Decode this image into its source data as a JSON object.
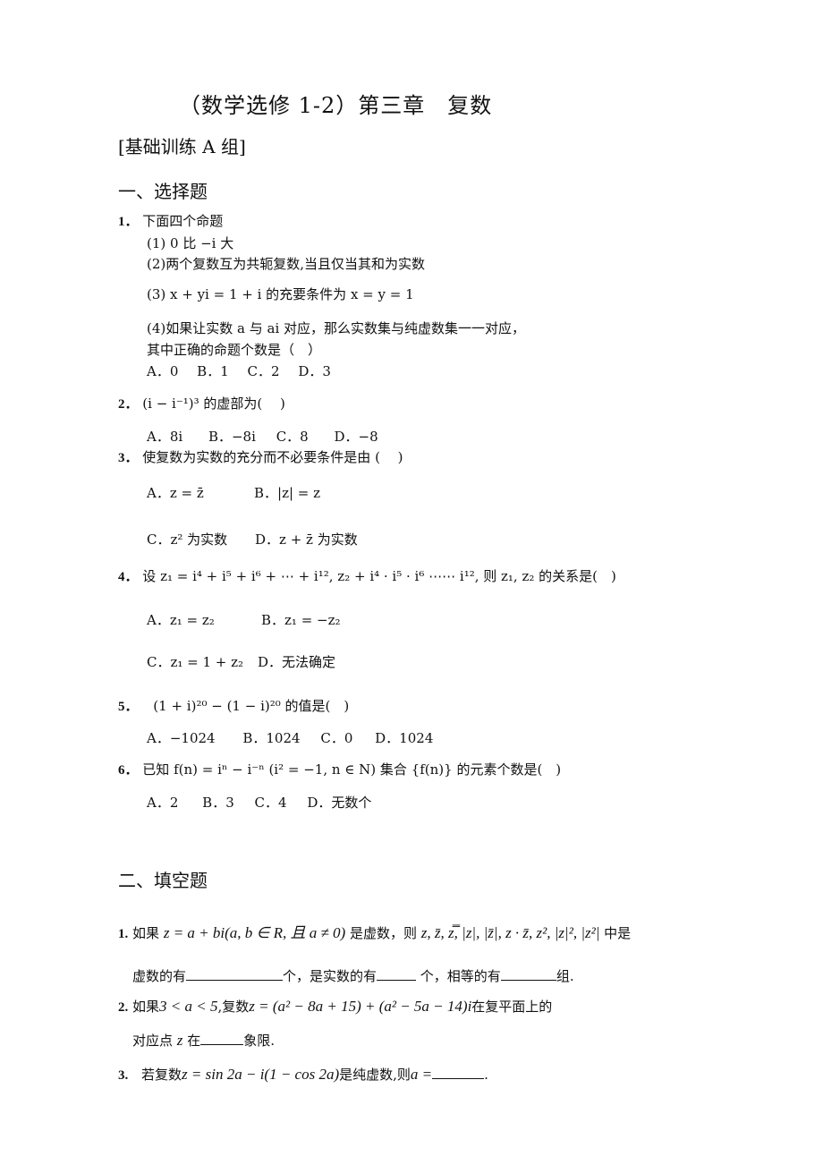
{
  "document": {
    "title": "（数学选修 1-2）第三章　复数",
    "subtitle": "[基础训练 A 组]",
    "section1": {
      "heading": "一、选择题",
      "questions": [
        {
          "num": "1．",
          "stem": "下面四个命题",
          "items": [
            "(1)  0 比 −i 大",
            "(2)两个复数互为共轭复数,当且仅当其和为实数",
            "(3)  x + yi = 1 + i 的充要条件为 x = y = 1",
            "(4)如果让实数 a 与 ai 对应，那么实数集与纯虚数集一一对应，"
          ],
          "tail": "其中正确的命题个数是（　）",
          "options": [
            "A．0",
            "B．1",
            "C．2",
            "D．3"
          ]
        },
        {
          "num": "2．",
          "stem": "(i − i⁻¹)³ 的虚部为(　 )",
          "options": [
            "A．8i",
            "B．−8i",
            "C．8",
            "D．−8"
          ]
        },
        {
          "num": "3．",
          "stem": "使复数为实数的充分而不必要条件是由 (　 )",
          "options": [
            "A．z = z̄",
            "B．|z| = z",
            "C．z² 为实数",
            "D．z + z̄ 为实数"
          ]
        },
        {
          "num": "4．",
          "stem": "设 z₁ = i⁴ + i⁵ + i⁶ + ⋯ + i¹², z₂ + i⁴ · i⁵ · i⁶ ⋯⋯ i¹², 则 z₁, z₂ 的关系是(　)",
          "options": [
            "A．z₁ = z₂",
            "B．z₁ = −z₂",
            "C．z₁ = 1 + z₂",
            "D．无法确定"
          ]
        },
        {
          "num": "5．",
          "stem": "(1 + i)²⁰ − (1 − i)²⁰ 的值是(　)",
          "options": [
            "A．−1024",
            "B．1024",
            "C．0",
            "D．1024"
          ]
        },
        {
          "num": "6．",
          "stem": "已知 f(n) = iⁿ − i⁻ⁿ (i² = −1, n ∈ N) 集合 {f(n)} 的元素个数是(　)",
          "options": [
            "A．2",
            "B．3",
            "C．4",
            "D．无数个"
          ]
        }
      ]
    },
    "section2": {
      "heading": "二、填空题",
      "questions": [
        {
          "num": "1.",
          "line1_text": "如果",
          "line1_math": "z = a + bi(a, b ∈ R, 且 a ≠ 0)",
          "line1_mid": "是虚数，则",
          "line1_list": "z, z̄, z̿, |z|, |z̄|, z · z̄, z², |z|², |z²|",
          "line1_end": "中是",
          "line2_a": "虚数的有",
          "line2_b": "个，是实数的有",
          "line2_c": " 个，相等的有",
          "line2_d": "组."
        },
        {
          "num": "2.",
          "line1_a": "如果",
          "line1_math1": "3 < a < 5",
          "line1_b": ",复数",
          "line1_math2": "z = (a² − 8a + 15) + (a² − 5a − 14)i",
          "line1_c": "在复平面上的",
          "line2_a": "对应点",
          "line2_math": "z",
          "line2_b": "在",
          "line2_c": "象限."
        },
        {
          "num": "3.",
          "line1_a": "若复数",
          "line1_math": "z = sin 2a − i(1 − cos 2a)",
          "line1_b": "是纯虚数,则",
          "line1_math2": "a =",
          "line1_end": "."
        }
      ]
    }
  }
}
